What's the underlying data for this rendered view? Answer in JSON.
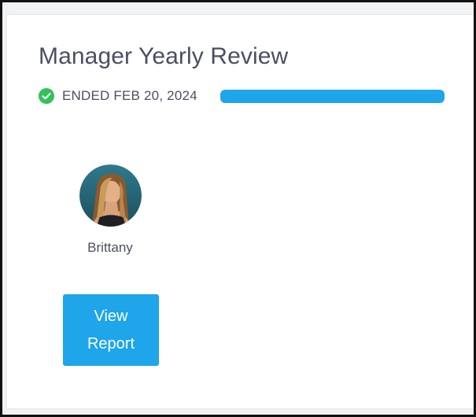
{
  "review": {
    "title": "Manager Yearly Review",
    "status_text": "ENDED FEB 20, 2024",
    "status_icon": "check-circle-icon",
    "progress_fraction": 1.0
  },
  "participant": {
    "name": "Brittany",
    "avatar_icon": "avatar-photo"
  },
  "actions": {
    "view_report_label": "View Report"
  },
  "colors": {
    "accent": "#1ea5ea",
    "success": "#33c15a",
    "text": "#4a4f63"
  }
}
